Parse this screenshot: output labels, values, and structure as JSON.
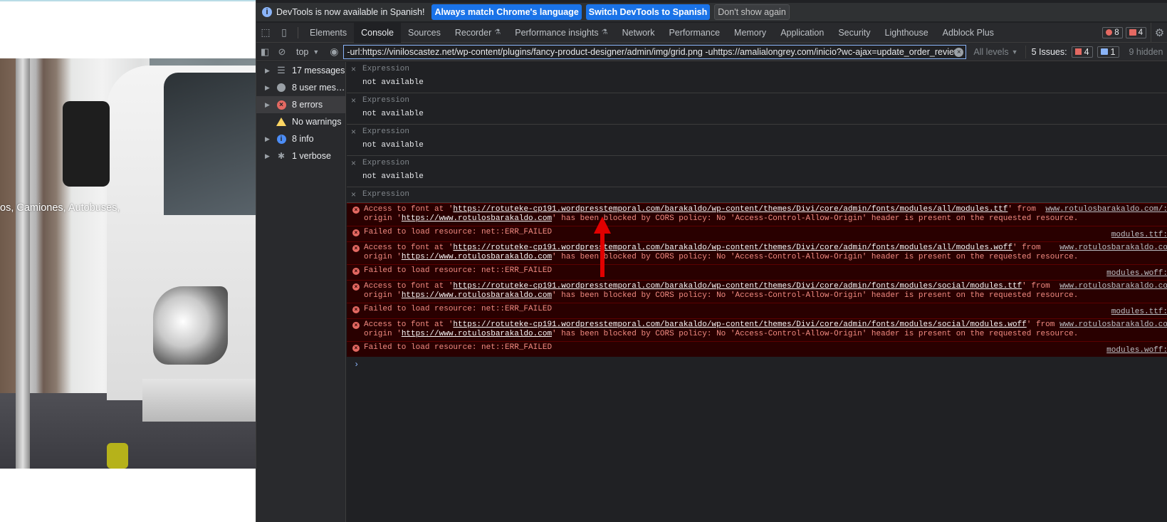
{
  "webpage": {
    "hero_caption": "os, Camiones, Autobuses,"
  },
  "infobar": {
    "message": "DevTools is now available in Spanish!",
    "btn_match": "Always match Chrome's language",
    "btn_switch": "Switch DevTools to Spanish",
    "btn_dismiss": "Don't show again"
  },
  "tabs": [
    "Elements",
    "Console",
    "Sources",
    "Recorder",
    "Performance insights",
    "Network",
    "Performance",
    "Memory",
    "Application",
    "Security",
    "Lighthouse",
    "Adblock Plus"
  ],
  "badges": {
    "errors": "8",
    "warnings": "4"
  },
  "filterbar": {
    "context": "top",
    "filter_value": "-url:https://viniloscastez.net/wp-content/plugins/fancy-product-designer/admin/img/grid.png -uhttps://amalialongrey.com/inicio?wc-ajax=update_order_review",
    "levels": "All levels",
    "issues_label": "5 Issues:",
    "issues_errors": "4",
    "issues_info": "1",
    "hidden": "9 hidden"
  },
  "sidebar": [
    {
      "label": "17 messages",
      "icon": "list-icon"
    },
    {
      "label": "8 user mes…",
      "icon": "user-icon"
    },
    {
      "label": "8 errors",
      "icon": "error-icon"
    },
    {
      "label": "No warnings",
      "icon": "warning-icon"
    },
    {
      "label": "8 info",
      "icon": "info-icon"
    },
    {
      "label": "1 verbose",
      "icon": "bug-icon"
    }
  ],
  "expressions": [
    {
      "label": "Expression",
      "value": "not available"
    },
    {
      "label": "Expression",
      "value": "not available"
    },
    {
      "label": "Expression",
      "value": "not available"
    },
    {
      "label": "Expression",
      "value": "not available"
    },
    {
      "label": "Expression",
      "value": ""
    }
  ],
  "errors": [
    {
      "p1": "Access to font at '",
      "url": "https://rotuteke-cp191.wordpresstemporal.com/barakaldo/wp-content/themes/Divi/core/admin/fonts/modules/all/modules.ttf",
      "p2": "' from ",
      "p3": "origin '",
      "origin": "https://www.rotulosbarakaldo.com",
      "p4": "' has been blocked by CORS policy: No 'Access-Control-Allow-Origin' header is present on the requested resource.",
      "source": "www.rotulosbarakaldo.com/:"
    },
    {
      "text": "Failed to load resource: net::ERR_FAILED",
      "source": "modules.ttf:"
    },
    {
      "p1": "Access to font at '",
      "url": "https://rotuteke-cp191.wordpresstemporal.com/barakaldo/wp-content/themes/Divi/core/admin/fonts/modules/all/modules.woff",
      "p2": "' from ",
      "p3": "origin '",
      "origin": "https://www.rotulosbarakaldo.com",
      "p4": "' has been blocked by CORS policy: No 'Access-Control-Allow-Origin' header is present on the requested resource.",
      "source": "www.rotulosbarakaldo.co"
    },
    {
      "text": "Failed to load resource: net::ERR_FAILED",
      "source": "modules.woff:"
    },
    {
      "p1": "Access to font at '",
      "url": "https://rotuteke-cp191.wordpresstemporal.com/barakaldo/wp-content/themes/Divi/core/admin/fonts/modules/social/modules.ttf",
      "p2": "' from ",
      "p3": "origin '",
      "origin": "https://www.rotulosbarakaldo.com",
      "p4": "' has been blocked by CORS policy: No 'Access-Control-Allow-Origin' header is present on the requested resource.",
      "source": "www.rotulosbarakaldo.co"
    },
    {
      "text": "Failed to load resource: net::ERR_FAILED",
      "source": "modules.ttf:"
    },
    {
      "p1": "Access to font at '",
      "url": "https://rotuteke-cp191.wordpresstemporal.com/barakaldo/wp-content/themes/Divi/core/admin/fonts/modules/social/modules.woff",
      "p2": "' from ",
      "p3": "origin '",
      "origin": "https://www.rotulosbarakaldo.com",
      "p4": "' has been blocked by CORS policy: No 'Access-Control-Allow-Origin' header is present on the requested resource.",
      "source": "www.rotulosbarakaldo.co"
    },
    {
      "text": "Failed to load resource: net::ERR_FAILED",
      "source": "modules.woff:"
    }
  ],
  "prompt": "›",
  "colors": {
    "accent": "#1a73e8",
    "error_bg": "#290000",
    "error_text": "#f28b82",
    "panel": "#202124",
    "annotation_arrow": "#e00000"
  }
}
